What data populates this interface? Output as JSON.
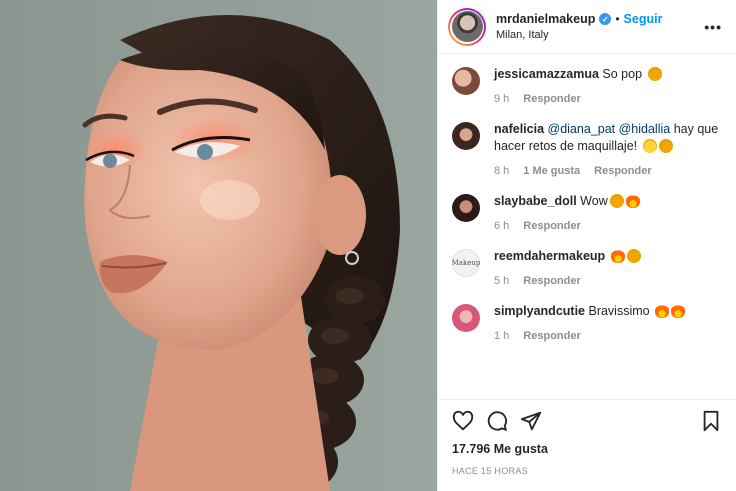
{
  "post": {
    "username": "mrdanielmakeup",
    "follow_label": "Seguir",
    "location": "Milan, Italy",
    "more_icon": "more-options-icon"
  },
  "comments": [
    {
      "user": "jessicamazzamua",
      "text": "So pop",
      "emoji": [
        "star-struck"
      ],
      "time": "9 h",
      "likes": "",
      "reply": "Responder",
      "avatar_color": "#b07a66"
    },
    {
      "user": "nafelicia",
      "mention1": "@diana_pat",
      "mention2": "@hidallia",
      "text": "hay que hacer retos de maquillaje!",
      "emoji": [
        "laughing",
        "star-struck"
      ],
      "time": "8 h",
      "likes": "1 Me gusta",
      "reply": "Responder",
      "avatar_color": "#5a3a30"
    },
    {
      "user": "slaybabe_doll",
      "text": "Wow",
      "emoji": [
        "star-struck",
        "fire"
      ],
      "time": "6 h",
      "likes": "",
      "reply": "Responder",
      "avatar_color": "#3b2a2a"
    },
    {
      "user": "reemdahermakeup",
      "avatar_text": "Makeup",
      "text": "",
      "emoji": [
        "fire",
        "star-struck"
      ],
      "time": "5 h",
      "likes": "",
      "reply": "Responder",
      "avatar_color": "#f2f2f2"
    },
    {
      "user": "simplyandcutie",
      "text": "Bravissimo",
      "emoji": [
        "fire",
        "fire"
      ],
      "time": "1 h",
      "likes": "",
      "reply": "Responder",
      "avatar_color": "#d8587a"
    }
  ],
  "actions": {
    "like_icon": "heart-icon",
    "comment_icon": "comment-icon",
    "share_icon": "share-icon",
    "save_icon": "bookmark-icon",
    "likes_count": "17.796",
    "likes_label": "Me gusta",
    "timestamp": "HACE 15 HORAS"
  },
  "colors": {
    "accent": "#0095f6",
    "mention": "#00376b",
    "muted": "#8e8e8e",
    "verified": "#3897f0"
  }
}
